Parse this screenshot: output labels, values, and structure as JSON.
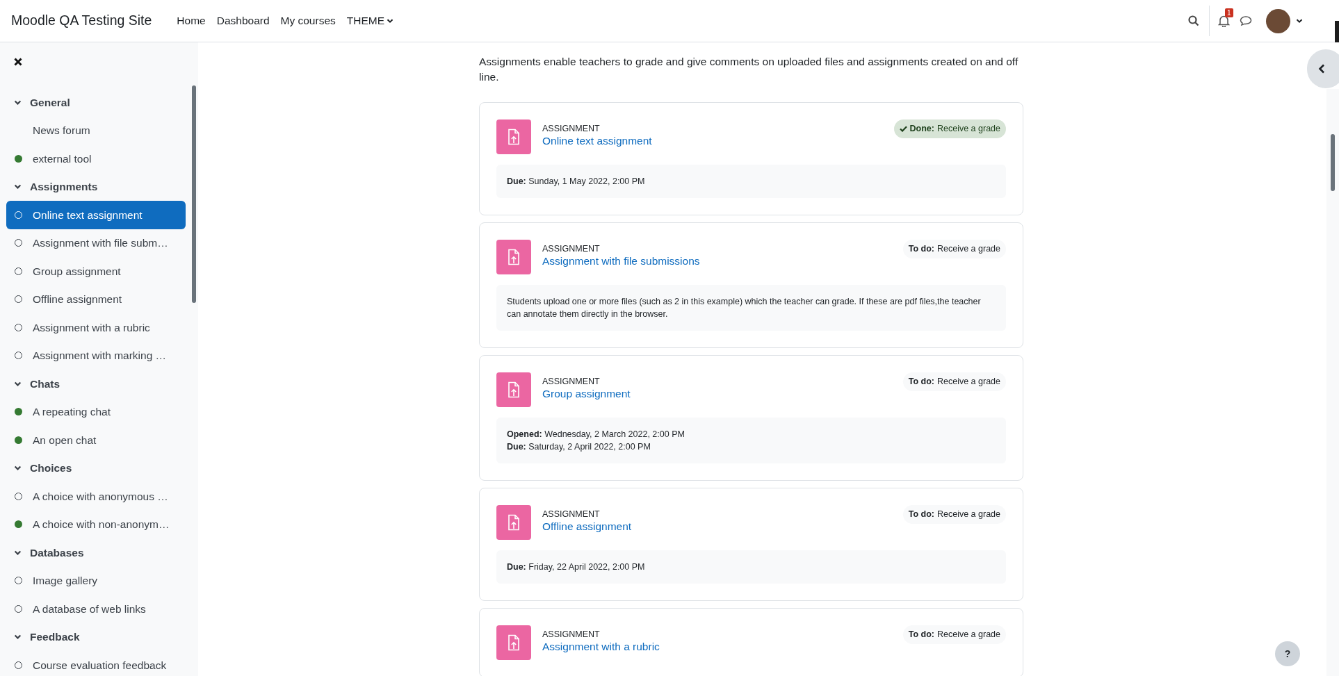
{
  "header": {
    "site_name": "Moodle QA Testing Site",
    "nav": [
      {
        "label": "Home",
        "dropdown": false
      },
      {
        "label": "Dashboard",
        "dropdown": false
      },
      {
        "label": "My courses",
        "dropdown": false
      },
      {
        "label": "THEME",
        "dropdown": true
      }
    ],
    "notification_count": "1"
  },
  "sidebar": {
    "sections": [
      {
        "title": "General",
        "expanded": true,
        "items": [
          {
            "label": "News forum",
            "kind": "plain",
            "selected": false
          },
          {
            "label": "external tool",
            "kind": "complete",
            "selected": false
          }
        ]
      },
      {
        "title": "Assignments",
        "expanded": true,
        "items": [
          {
            "label": "Online text assignment",
            "kind": "incomplete",
            "selected": true
          },
          {
            "label": "Assignment with file subm…",
            "kind": "incomplete",
            "selected": false
          },
          {
            "label": "Group assignment",
            "kind": "incomplete",
            "selected": false
          },
          {
            "label": "Offline assignment",
            "kind": "incomplete",
            "selected": false
          },
          {
            "label": "Assignment with a rubric",
            "kind": "incomplete",
            "selected": false
          },
          {
            "label": "Assignment with marking …",
            "kind": "incomplete",
            "selected": false
          }
        ]
      },
      {
        "title": "Chats",
        "expanded": true,
        "items": [
          {
            "label": "A repeating chat",
            "kind": "complete",
            "selected": false
          },
          {
            "label": "An open chat",
            "kind": "complete",
            "selected": false
          }
        ]
      },
      {
        "title": "Choices",
        "expanded": true,
        "items": [
          {
            "label": "A choice with anonymous …",
            "kind": "incomplete",
            "selected": false
          },
          {
            "label": "A choice with non-anonym…",
            "kind": "complete",
            "selected": false
          }
        ]
      },
      {
        "title": "Databases",
        "expanded": true,
        "items": [
          {
            "label": "Image gallery",
            "kind": "incomplete",
            "selected": false
          },
          {
            "label": "A database of web links",
            "kind": "incomplete",
            "selected": false
          }
        ]
      },
      {
        "title": "Feedback",
        "expanded": true,
        "items": [
          {
            "label": "Course evaluation feedback",
            "kind": "incomplete",
            "selected": false
          }
        ]
      }
    ]
  },
  "intro": "Assignments enable teachers to grade and give comments on uploaded files and assignments created on and off line.",
  "activities": [
    {
      "type": "ASSIGNMENT",
      "name": "Online text assignment",
      "status": {
        "kind": "done",
        "label": "Done:",
        "text": "Receive a grade"
      },
      "details": [
        {
          "kind": "date",
          "label": "Due:",
          "value": "Sunday, 1 May 2022, 2:00 PM"
        }
      ]
    },
    {
      "type": "ASSIGNMENT",
      "name": "Assignment with file submissions",
      "status": {
        "kind": "todo",
        "label": "To do:",
        "text": "Receive a grade"
      },
      "details": [
        {
          "kind": "text",
          "value": "Students upload one or more files (such as 2 in this example) which the teacher can grade. If these are pdf files,the teacher can annotate them directly in the browser."
        }
      ]
    },
    {
      "type": "ASSIGNMENT",
      "name": "Group assignment",
      "status": {
        "kind": "todo",
        "label": "To do:",
        "text": "Receive a grade"
      },
      "details": [
        {
          "kind": "date",
          "label": "Opened:",
          "value": "Wednesday, 2 March 2022, 2:00 PM"
        },
        {
          "kind": "date",
          "label": "Due:",
          "value": "Saturday, 2 April 2022, 2:00 PM"
        }
      ]
    },
    {
      "type": "ASSIGNMENT",
      "name": "Offline assignment",
      "status": {
        "kind": "todo",
        "label": "To do:",
        "text": "Receive a grade"
      },
      "details": [
        {
          "kind": "date",
          "label": "Due:",
          "value": "Friday, 22 April 2022, 2:00 PM"
        }
      ]
    },
    {
      "type": "ASSIGNMENT",
      "name": "Assignment with a rubric",
      "status": {
        "kind": "todo",
        "label": "To do:",
        "text": "Receive a grade"
      }
    }
  ],
  "help_button": "?"
}
